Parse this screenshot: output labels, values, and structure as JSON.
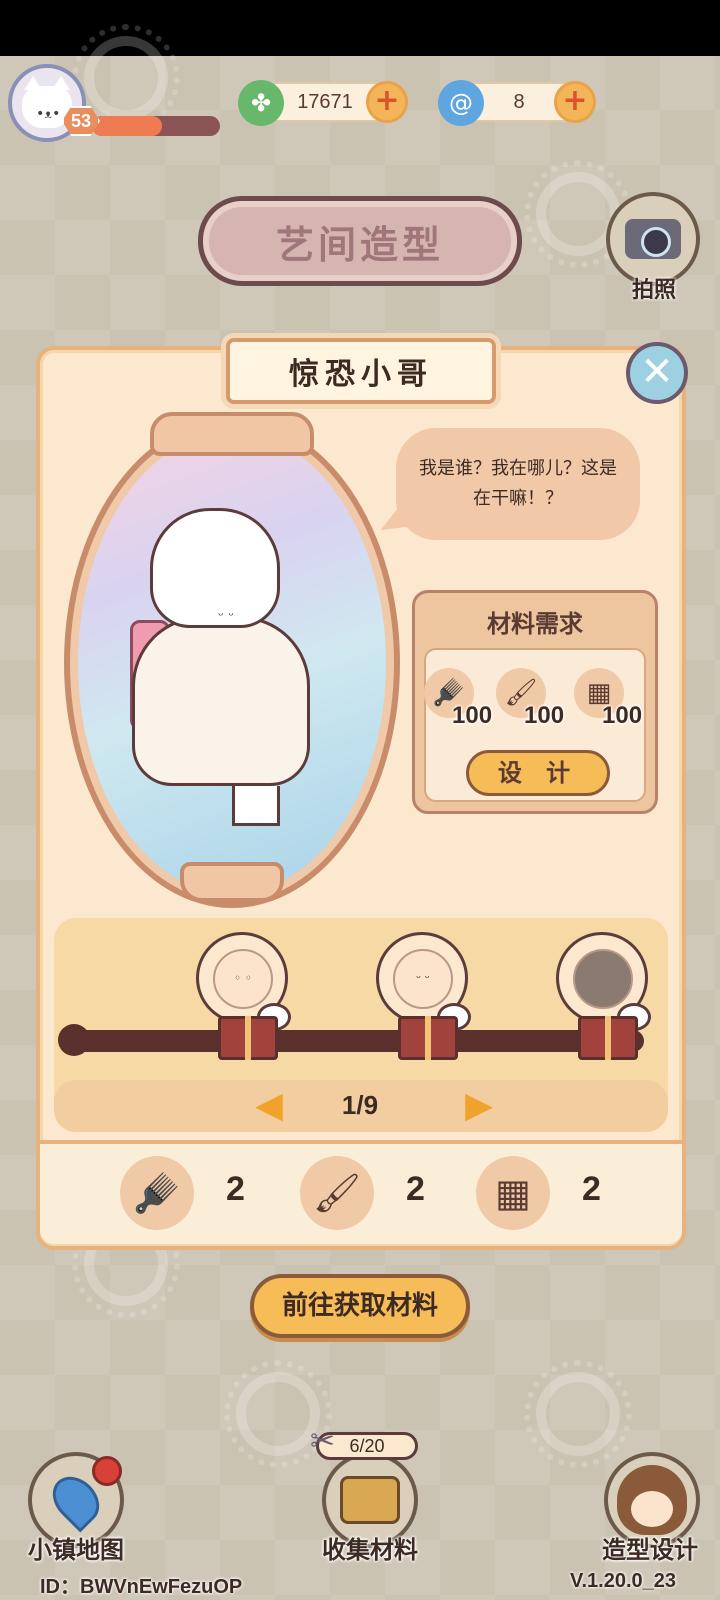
{
  "hud": {
    "level": "53",
    "xp_progress": 0.55,
    "currency_clover": {
      "icon": "clover-icon",
      "value": "17671"
    },
    "currency_swirl": {
      "icon": "swirl-icon",
      "value": "8"
    }
  },
  "header": {
    "title": "艺间造型",
    "camera_label": "拍照"
  },
  "panel": {
    "character_name": "惊恐小哥",
    "speech": "我是谁？我在哪儿？这是在干嘛！？",
    "materials": {
      "title": "材料需求",
      "items": [
        {
          "icon": "hair-dryer-icon",
          "count": "100"
        },
        {
          "icon": "makeup-brush-icon",
          "count": "100"
        },
        {
          "icon": "comb-icon",
          "count": "100"
        }
      ],
      "design_label": "设 计"
    },
    "pager": {
      "text": "1/9"
    },
    "inventory": [
      {
        "icon": "hair-dryer-icon",
        "count": "2"
      },
      {
        "icon": "makeup-brush-icon",
        "count": "2"
      },
      {
        "icon": "comb-icon",
        "count": "2"
      }
    ]
  },
  "go_get_label": "前往获取材料",
  "bottom_nav": {
    "map_label": "小镇地图",
    "collect_label": "收集材料",
    "collect_progress": "6/20",
    "design_label": "造型设计"
  },
  "footer": {
    "id": "ID：BWVnEwFezuOP",
    "version": "V.1.20.0_23"
  },
  "colors": {
    "accent_orange": "#f5bc57",
    "panel_bg": "#fbe8cf",
    "frame_brown": "#5b2f2c"
  }
}
